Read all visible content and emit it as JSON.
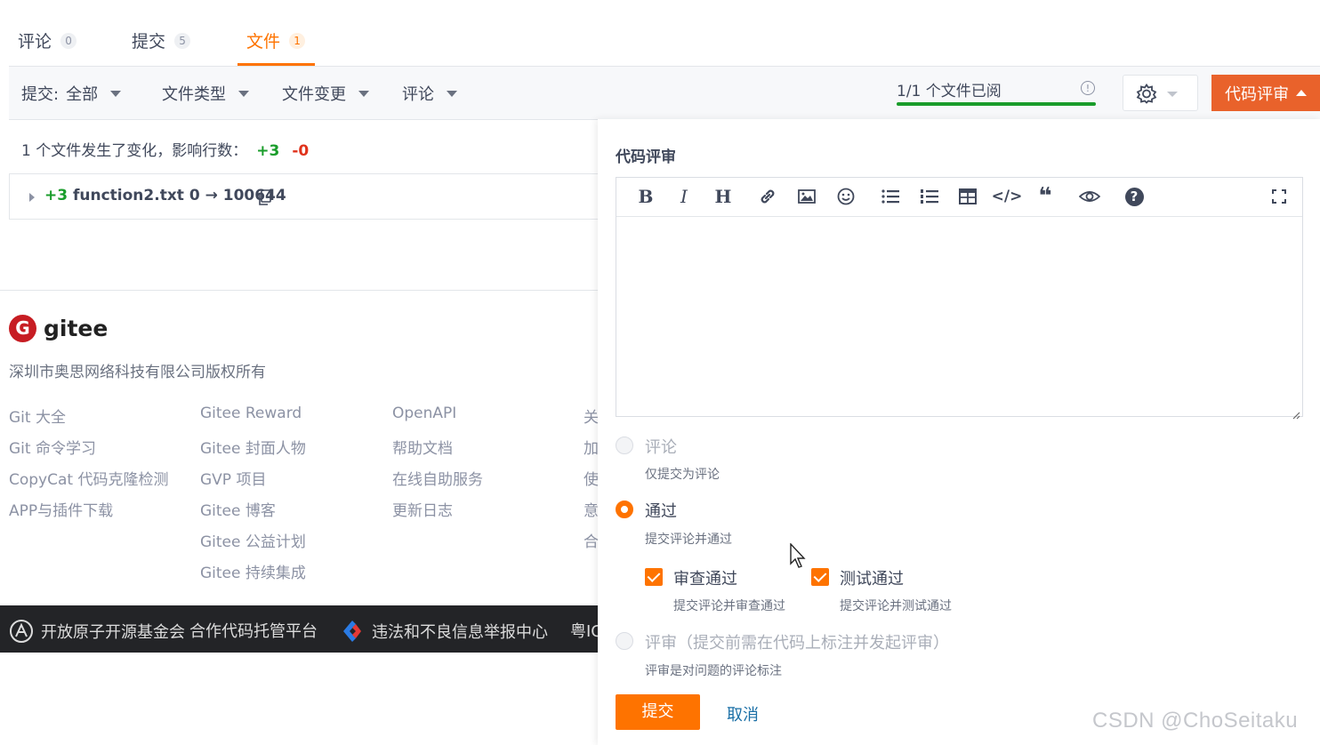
{
  "tabs": [
    {
      "label": "评论",
      "count": "0"
    },
    {
      "label": "提交",
      "count": "5"
    },
    {
      "label": "文件",
      "count": "1"
    }
  ],
  "filters": {
    "commit_label": "提交:",
    "commit_value": "全部",
    "file_type": "文件类型",
    "file_change": "文件变更",
    "comment": "评论"
  },
  "review_progress": {
    "text": "1/1 个文件已阅",
    "info": "!",
    "fraction": 1.0
  },
  "code_review_button": "代码评审",
  "summary": {
    "text": "1 个文件发生了变化，影响行数：",
    "added": "+3",
    "removed": "-0"
  },
  "file": {
    "added": "+3",
    "name": "function2.txt 0 → 100644"
  },
  "footer": {
    "logo_letter": "G",
    "logo_text": "gitee",
    "copyright": "深圳市奥思网络科技有限公司版权所有",
    "columns": [
      [
        "Git 大全",
        "Git 命令学习",
        "CopyCat 代码克隆检测",
        "APP与插件下载"
      ],
      [
        "Gitee Reward",
        "Gitee 封面人物",
        "GVP 项目",
        "Gitee 博客",
        "Gitee 公益计划",
        "Gitee 持续集成"
      ],
      [
        "OpenAPI",
        "帮助文档",
        "在线自助服务",
        "更新日志"
      ],
      [
        "关",
        "加",
        "使",
        "意",
        "合"
      ]
    ],
    "bar": {
      "item1": "开放原子开源基金会",
      "item2": "合作代码托管平台",
      "item3": "违法和不良信息举报中心",
      "item4": "粤IC"
    }
  },
  "panel": {
    "title": "代码评审",
    "toolbar": {
      "bold": "B",
      "italic": "I",
      "heading": "H",
      "link": "link-icon",
      "image": "image-icon",
      "emoji": "emoji-icon",
      "ul": "bulleted-list-icon",
      "ol": "numbered-list-icon",
      "table": "table-icon",
      "code": "</>",
      "quote": "❝",
      "preview": "eye-icon",
      "help": "?",
      "fullscreen": "fullscreen-icon"
    },
    "options": [
      {
        "label": "评论",
        "desc": "仅提交为评论",
        "selected": false
      },
      {
        "label": "通过",
        "desc": "提交评论并通过",
        "selected": true
      },
      {
        "label": "评审（提交前需在代码上标注并发起评审）",
        "desc": "评审是对问题的评论标注",
        "selected": false
      }
    ],
    "checks": [
      {
        "label": "审查通过",
        "desc": "提交评论并审查通过",
        "checked": true
      },
      {
        "label": "测试通过",
        "desc": "提交评论并测试通过",
        "checked": true
      }
    ],
    "submit": "提交",
    "cancel": "取消"
  },
  "watermark": "CSDN @ChoSeitaku",
  "colors": {
    "accent": "#fe7300",
    "review_button": "#e9622b",
    "add": "#1a9d2b",
    "remove": "#e0321b",
    "progress": "#1a9d2b"
  }
}
